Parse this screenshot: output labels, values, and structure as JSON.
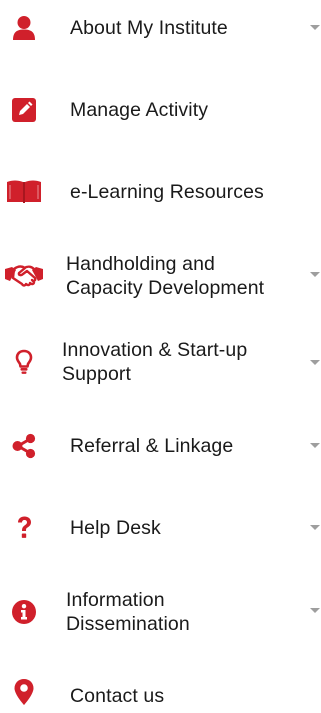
{
  "colors": {
    "icon": "#d0202b",
    "text": "#1a1a1a",
    "caret": "#9e9e9e"
  },
  "menu": {
    "items": [
      {
        "icon": "user-icon",
        "lines": [
          "About My Institute"
        ],
        "has_submenu": true
      },
      {
        "icon": "edit-icon",
        "lines": [
          "Manage Activity"
        ],
        "has_submenu": false
      },
      {
        "icon": "book-icon",
        "lines": [
          "e-Learning Resources"
        ],
        "has_submenu": false
      },
      {
        "icon": "handshake-icon",
        "lines": [
          "Handholding and",
          "Capacity Development"
        ],
        "has_submenu": true
      },
      {
        "icon": "lightbulb-icon",
        "lines": [
          "Innovation & Start-up",
          "Support"
        ],
        "has_submenu": true
      },
      {
        "icon": "share-icon",
        "lines": [
          "Referral & Linkage"
        ],
        "has_submenu": true
      },
      {
        "icon": "question-icon",
        "lines": [
          "Help Desk"
        ],
        "has_submenu": true
      },
      {
        "icon": "info-icon",
        "lines": [
          "Information",
          "Dissemination"
        ],
        "has_submenu": true
      },
      {
        "icon": "map-marker-icon",
        "lines": [
          "Contact us"
        ],
        "has_submenu": false
      }
    ]
  }
}
